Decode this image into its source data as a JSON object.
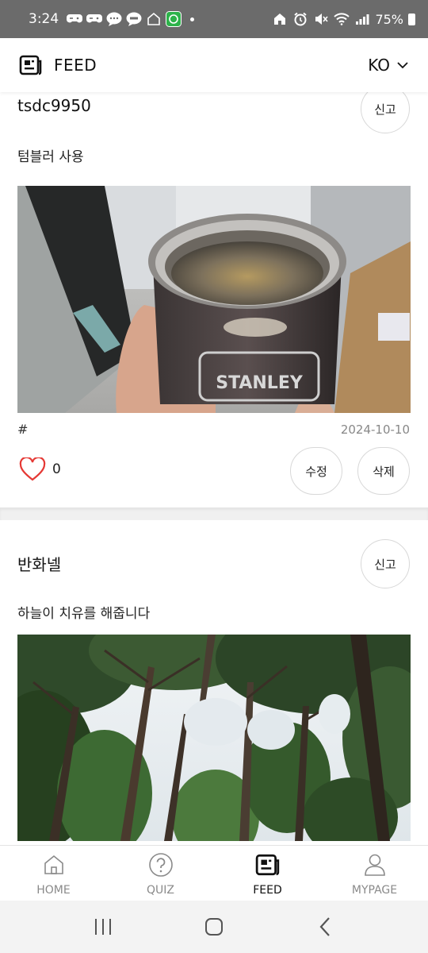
{
  "status_bar": {
    "time": "3:24",
    "battery": "75%"
  },
  "header": {
    "title": "FEED",
    "language": "KO"
  },
  "posts": [
    {
      "author": "tsdc9950",
      "report_label": "신고",
      "text": "텀블러 사용",
      "photo_label": "STANLEY",
      "hashtag": "#",
      "date": "2024-10-10",
      "likes": "0",
      "edit_label": "수정",
      "delete_label": "삭제"
    },
    {
      "author": "반화넬",
      "report_label": "신고",
      "text": "하늘이 치유를 해줍니다"
    }
  ],
  "bottom_nav": {
    "items": [
      {
        "label": "HOME",
        "icon": "home-icon"
      },
      {
        "label": "QUIZ",
        "icon": "question-icon"
      },
      {
        "label": "FEED",
        "icon": "feed-icon",
        "active": true
      },
      {
        "label": "MYPAGE",
        "icon": "person-icon"
      }
    ]
  },
  "colors": {
    "heart": "#e53935",
    "status_bar": "#6b6b6b",
    "active_nav": "#111111",
    "inactive_nav": "#8a8a8a"
  }
}
